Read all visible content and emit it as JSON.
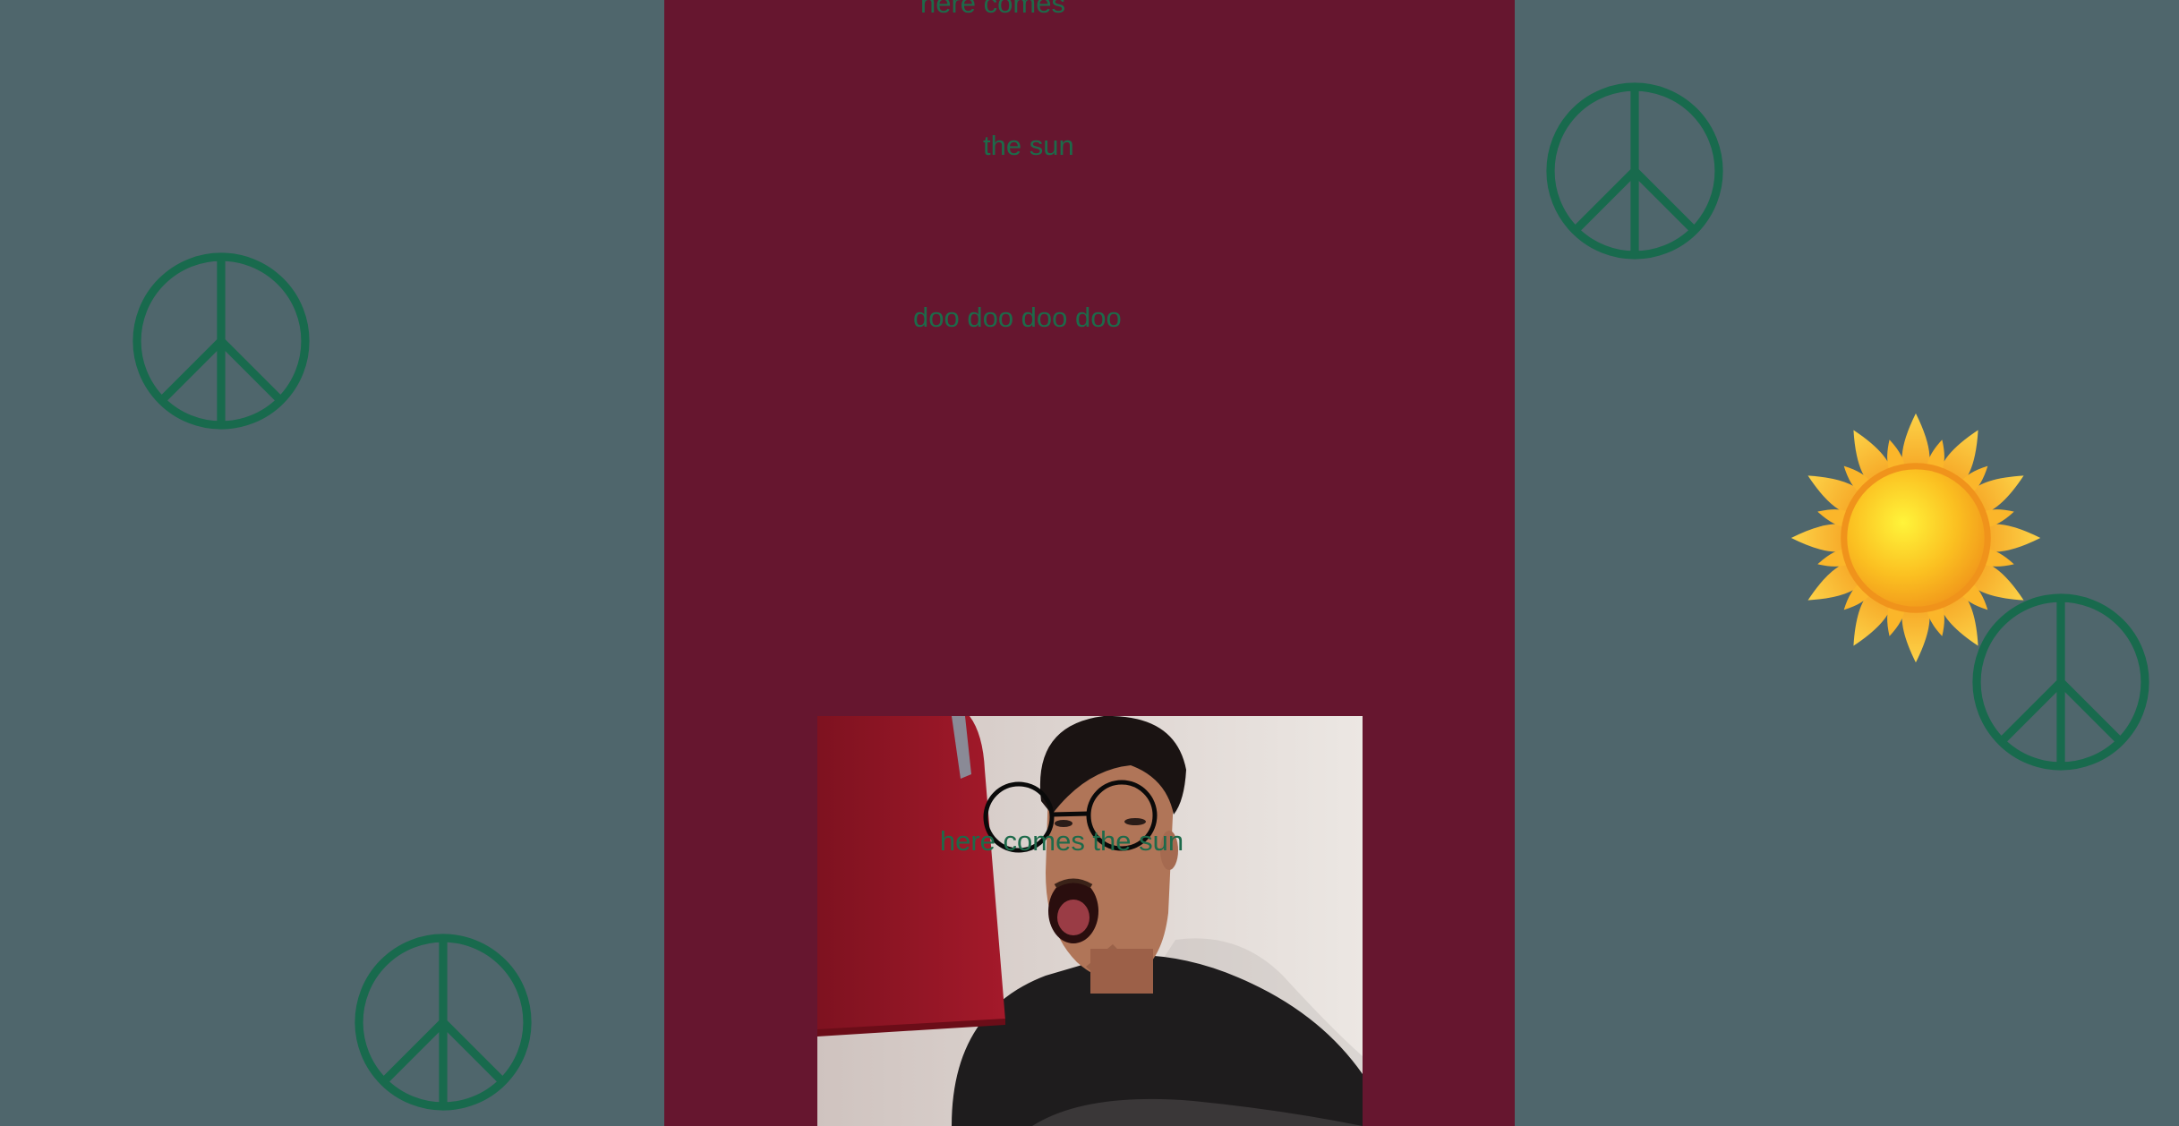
{
  "colors": {
    "background": "#4f666c",
    "panel": "#66162f",
    "lyric_text": "#1d6a4a",
    "peace_symbol": "#186a4d",
    "sun_outer": "#f6a623",
    "sun_core": "#fbd321"
  },
  "icons": {
    "peace": "peace-sign-icon",
    "sun": "sun-icon"
  },
  "lyrics": {
    "line1": "here comes",
    "line2": "the sun",
    "line3": "doo doo doo doo",
    "overlay": "here comes the sun"
  },
  "webcam": {
    "filter": "round-glasses",
    "person_expression": "surprised"
  }
}
